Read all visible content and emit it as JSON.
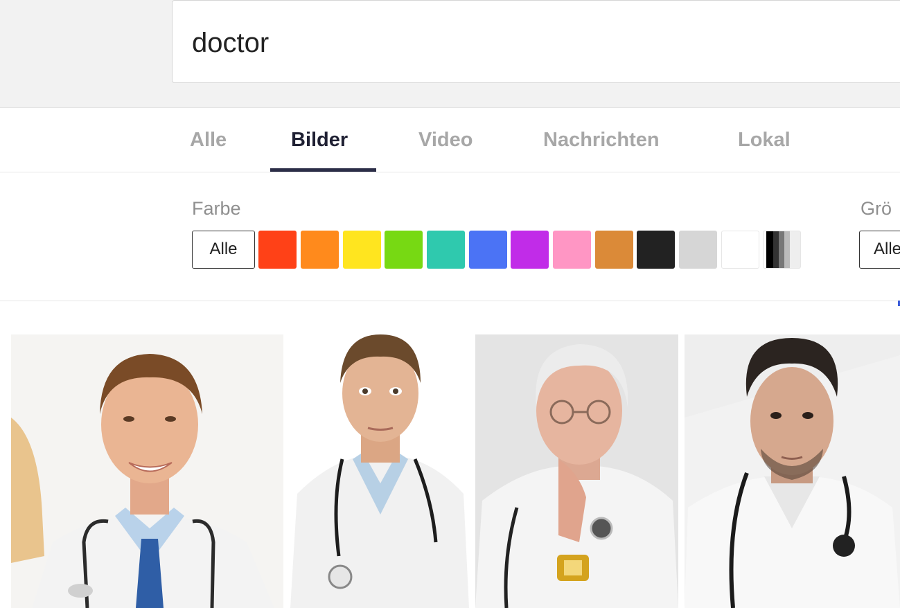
{
  "search": {
    "query": "doctor"
  },
  "tabs": [
    {
      "label": "Alle"
    },
    {
      "label": "Bilder"
    },
    {
      "label": "Video"
    },
    {
      "label": "Nachrichten"
    },
    {
      "label": "Lokal"
    }
  ],
  "active_tab": "Bilder",
  "filters": {
    "color": {
      "title": "Farbe",
      "all_label": "Alle",
      "swatches": [
        "#ff4117",
        "#ff8a1c",
        "#ffe51f",
        "#77d913",
        "#2fc9ae",
        "#4b73f5",
        "#c12ce8",
        "#ff96c4",
        "#db8a38",
        "#222222",
        "#d6d6d6",
        "#ffffff",
        "black-and-white"
      ]
    },
    "size": {
      "title": "Grö",
      "all_label": "Alle"
    }
  },
  "results": [
    {
      "name": "doctor-image-1"
    },
    {
      "name": "doctor-image-2"
    },
    {
      "name": "doctor-image-3"
    },
    {
      "name": "doctor-image-4"
    }
  ]
}
